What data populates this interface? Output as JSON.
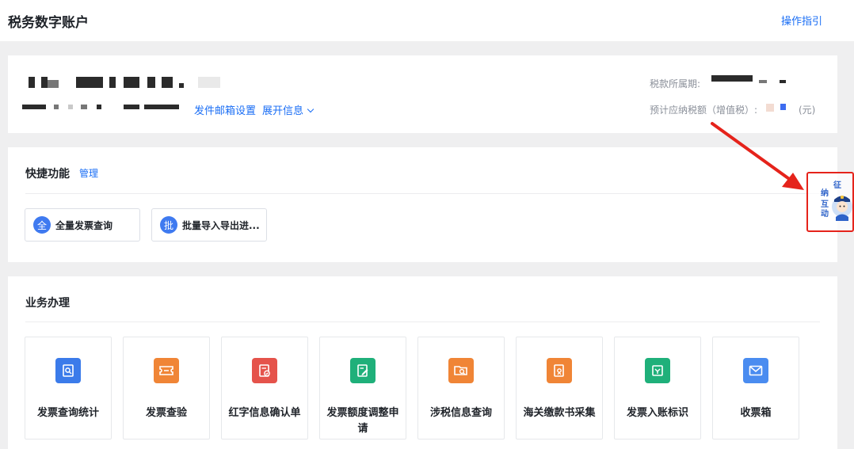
{
  "header": {
    "title": "税务数字账户",
    "guide_link": "操作指引"
  },
  "account": {
    "mail_settings_link": "发件邮箱设置",
    "expand_info_link": "展开信息",
    "tax_period_label": "税款所属期:",
    "estimated_tax_label": "预计应纳税额（增值税）:",
    "tax_unit": "(元)"
  },
  "quick": {
    "title": "快捷功能",
    "manage_link": "管理",
    "items": [
      {
        "icon_char": "全",
        "label": "全量发票查询"
      },
      {
        "icon_char": "批",
        "label": "批量导入导出进..."
      }
    ]
  },
  "business": {
    "title": "业务办理",
    "tiles": [
      {
        "label": "发票查询统计",
        "icon": "invoice-search-icon",
        "color": "#3b7bea"
      },
      {
        "label": "发票查验",
        "icon": "ticket-icon",
        "color": "#f08536"
      },
      {
        "label": "红字信息确认单",
        "icon": "red-invoice-check-icon",
        "color": "#e5534b"
      },
      {
        "label": "发票额度调整申请",
        "icon": "edit-document-icon",
        "color": "#1fb07a"
      },
      {
        "label": "涉税信息查询",
        "icon": "folder-search-icon",
        "color": "#f08536"
      },
      {
        "label": "海关缴款书采集",
        "icon": "customs-document-icon",
        "color": "#f08536"
      },
      {
        "label": "发票入账标识",
        "icon": "invoice-tag-icon",
        "color": "#1fb07a"
      },
      {
        "label": "收票箱",
        "icon": "mail-icon",
        "color": "#4a8cf0"
      }
    ]
  },
  "floating": {
    "chars": [
      "征",
      "纳",
      "互",
      "动"
    ]
  },
  "colors": {
    "accent": "#1a6ef5",
    "highlight_red": "#e5231b"
  }
}
